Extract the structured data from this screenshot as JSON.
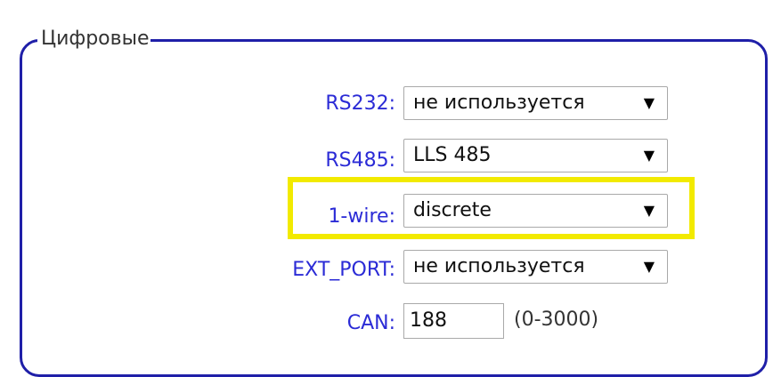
{
  "group": {
    "title": "Цифровые"
  },
  "rows": [
    {
      "label": "RS232:",
      "value": "не используется"
    },
    {
      "label": "RS485:",
      "value": "LLS 485"
    },
    {
      "label": "1-wire:",
      "value": "discrete"
    },
    {
      "label": "EXT_PORT:",
      "value": "не используется"
    }
  ],
  "can": {
    "label": "CAN:",
    "value": "188",
    "range_hint": "(0-3000)"
  },
  "colors": {
    "border": "#1f1fa8",
    "label": "#2b2bd6",
    "highlight": "#f2ea00"
  },
  "icons": {
    "dropdown": "triangle-down-icon"
  }
}
